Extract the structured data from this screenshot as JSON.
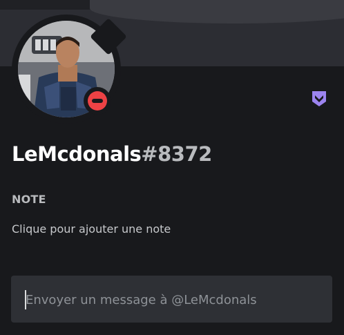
{
  "profile": {
    "username": "LeMcdonals",
    "discriminator": "#8372",
    "status": "do-not-disturb",
    "status_color": "#ed4245",
    "badge_icon": "hypesquad-badge-icon",
    "badge_color": "#9c84ef"
  },
  "note": {
    "label": "NOTE",
    "placeholder": "Clique pour ajouter une note"
  },
  "message": {
    "placeholder": "Envoyer un message à @LeMcdonals"
  },
  "colors": {
    "background": "#18191c",
    "banner": "#2c2d33",
    "input_bg": "#2e3035"
  }
}
